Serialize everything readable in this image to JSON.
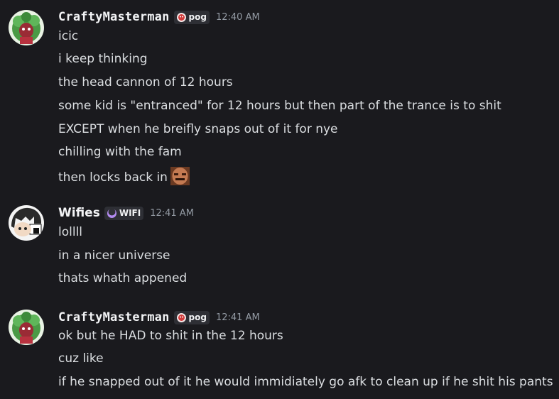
{
  "groups": [
    {
      "username": "CraftyMasterman",
      "tag": "pog",
      "timestamp": "12:40 AM",
      "messages": [
        "icic",
        "i keep thinking",
        "the head cannon of 12 hours",
        "some kid is \"entranced\" for 12 hours but then part of the trance is to shit",
        "EXCEPT when he breifly snaps out of it for nye",
        "chilling with the fam",
        "then locks back in"
      ]
    },
    {
      "username": "Wifies",
      "tag": "WIFI",
      "timestamp": "12:41 AM",
      "messages": [
        "lollll",
        "in a nicer universe",
        "thats whath appened"
      ]
    },
    {
      "username": "CraftyMasterman",
      "tag": "pog",
      "timestamp": "12:41 AM",
      "messages": [
        "ok but he HAD to shit in the 12 hours",
        "cuz like",
        "if he snapped out of it he would immidiately go afk to clean up if he shit his pants"
      ]
    }
  ],
  "icons": {
    "pog_tag": "pog-badge-icon",
    "wifi_tag": "moon-badge-icon",
    "emoji": "face-emoji"
  },
  "colors": {
    "background": "#1a1a1e",
    "username": "#f2f3f5",
    "message": "#dbdee1",
    "timestamp": "#949ba4",
    "tag_background": "#2e2f35"
  }
}
